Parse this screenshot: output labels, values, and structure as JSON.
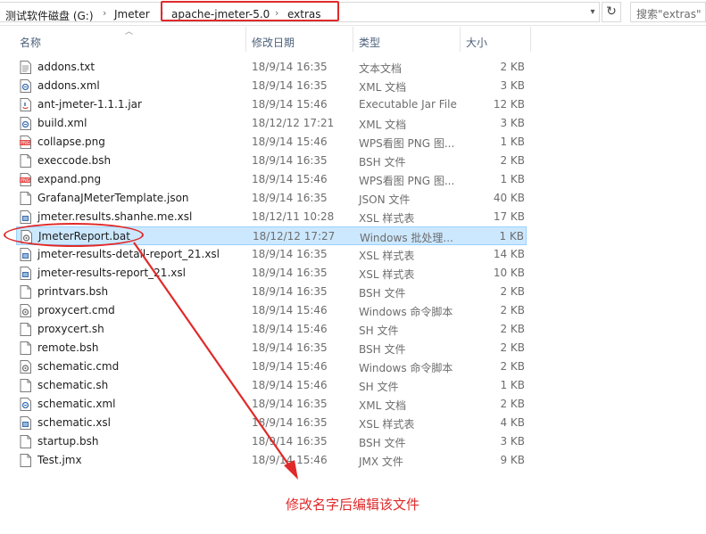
{
  "address_bar": {
    "crumbs": [
      "测试软件磁盘 (G:)",
      "Jmeter",
      "apache-jmeter-5.0",
      "extras"
    ],
    "search_placeholder": "搜索\"extras\""
  },
  "columns": {
    "name": "名称",
    "date": "修改日期",
    "type": "类型",
    "size": "大小"
  },
  "files": [
    {
      "name": "addons.txt",
      "date": "18/9/14 16:35",
      "type": "文本文档",
      "size": "2 KB",
      "icon": "text-file-icon"
    },
    {
      "name": "addons.xml",
      "date": "18/9/14 16:35",
      "type": "XML 文档",
      "size": "3 KB",
      "icon": "xml-file-icon"
    },
    {
      "name": "ant-jmeter-1.1.1.jar",
      "date": "18/9/14 15:46",
      "type": "Executable Jar File",
      "size": "12 KB",
      "icon": "jar-file-icon"
    },
    {
      "name": "build.xml",
      "date": "18/12/12 17:21",
      "type": "XML 文档",
      "size": "3 KB",
      "icon": "xml-file-icon"
    },
    {
      "name": "collapse.png",
      "date": "18/9/14 15:46",
      "type": "WPS看图 PNG 图...",
      "size": "1 KB",
      "icon": "png-file-icon"
    },
    {
      "name": "execcode.bsh",
      "date": "18/9/14 16:35",
      "type": "BSH 文件",
      "size": "2 KB",
      "icon": "blank-file-icon"
    },
    {
      "name": "expand.png",
      "date": "18/9/14 15:46",
      "type": "WPS看图 PNG 图...",
      "size": "1 KB",
      "icon": "png-file-icon"
    },
    {
      "name": "GrafanaJMeterTemplate.json",
      "date": "18/9/14 16:35",
      "type": "JSON 文件",
      "size": "40 KB",
      "icon": "blank-file-icon"
    },
    {
      "name": "jmeter.results.shanhe.me.xsl",
      "date": "18/12/11 10:28",
      "type": "XSL 样式表",
      "size": "17 KB",
      "icon": "xsl-file-icon"
    },
    {
      "name": "JmeterReport.bat",
      "date": "18/12/12 17:27",
      "type": "Windows 批处理...",
      "size": "1 KB",
      "icon": "bat-file-icon",
      "selected": true
    },
    {
      "name": "jmeter-results-detail-report_21.xsl",
      "date": "18/9/14 16:35",
      "type": "XSL 样式表",
      "size": "14 KB",
      "icon": "xsl-file-icon"
    },
    {
      "name": "jmeter-results-report_21.xsl",
      "date": "18/9/14 16:35",
      "type": "XSL 样式表",
      "size": "10 KB",
      "icon": "xsl-file-icon"
    },
    {
      "name": "printvars.bsh",
      "date": "18/9/14 16:35",
      "type": "BSH 文件",
      "size": "2 KB",
      "icon": "blank-file-icon"
    },
    {
      "name": "proxycert.cmd",
      "date": "18/9/14 15:46",
      "type": "Windows 命令脚本",
      "size": "2 KB",
      "icon": "cmd-file-icon"
    },
    {
      "name": "proxycert.sh",
      "date": "18/9/14 15:46",
      "type": "SH 文件",
      "size": "2 KB",
      "icon": "blank-file-icon"
    },
    {
      "name": "remote.bsh",
      "date": "18/9/14 16:35",
      "type": "BSH 文件",
      "size": "2 KB",
      "icon": "blank-file-icon"
    },
    {
      "name": "schematic.cmd",
      "date": "18/9/14 15:46",
      "type": "Windows 命令脚本",
      "size": "2 KB",
      "icon": "cmd-file-icon"
    },
    {
      "name": "schematic.sh",
      "date": "18/9/14 15:46",
      "type": "SH 文件",
      "size": "1 KB",
      "icon": "blank-file-icon"
    },
    {
      "name": "schematic.xml",
      "date": "18/9/14 16:35",
      "type": "XML 文档",
      "size": "2 KB",
      "icon": "xml-file-icon"
    },
    {
      "name": "schematic.xsl",
      "date": "18/9/14 16:35",
      "type": "XSL 样式表",
      "size": "4 KB",
      "icon": "xsl-file-icon"
    },
    {
      "name": "startup.bsh",
      "date": "18/9/14 16:35",
      "type": "BSH 文件",
      "size": "3 KB",
      "icon": "blank-file-icon"
    },
    {
      "name": "Test.jmx",
      "date": "18/9/14 15:46",
      "type": "JMX 文件",
      "size": "9 KB",
      "icon": "blank-file-icon"
    }
  ],
  "annotation": {
    "text": "修改名字后编辑该文件"
  },
  "colors": {
    "highlight": "#e02a2a",
    "selection": "#cce8ff",
    "header_text": "#4c607a"
  }
}
